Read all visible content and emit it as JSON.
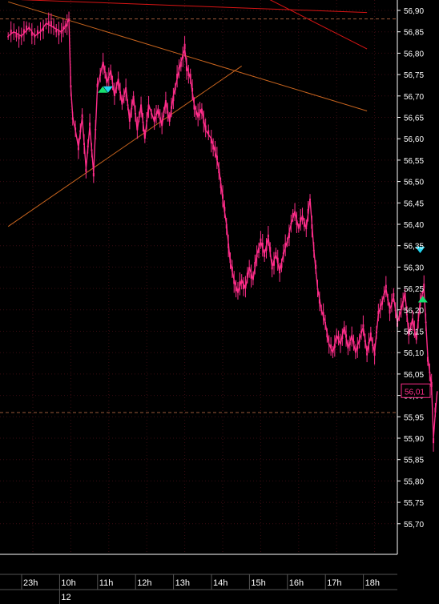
{
  "chart_data": {
    "type": "candlestick",
    "colors": {
      "background": "#000000",
      "candle": "#ff2d8a",
      "grid": "#3a0c12",
      "axis_text": "#ffffff",
      "trendline_orange": "#c8641e",
      "trendline_red": "#d81414",
      "last_price_box": "#ff2d8a",
      "signal_buy": "#19e070",
      "signal_sell": "#22d5f0"
    },
    "y_axis": {
      "min": 55.66,
      "max": 56.92,
      "ticks": [
        "56,90",
        "56,85",
        "56,80",
        "56,75",
        "56,70",
        "56,65",
        "56,60",
        "56,55",
        "56,50",
        "56,45",
        "56,40",
        "56,35",
        "56,30",
        "56,25",
        "56,20",
        "56,15",
        "56,10",
        "56,05",
        "56,00",
        "55,95",
        "55,90",
        "55,85",
        "55,80",
        "55,75",
        "55,70"
      ]
    },
    "last_price": {
      "value": 56.01,
      "label": "56,01"
    },
    "x_axis": {
      "ticks": [
        {
          "t": 23,
          "label": "23h"
        },
        {
          "t": 24,
          "label": "10h"
        },
        {
          "t": 25,
          "label": "11h"
        },
        {
          "t": 26,
          "label": "12h"
        },
        {
          "t": 27,
          "label": "13h"
        },
        {
          "t": 28,
          "label": "14h"
        },
        {
          "t": 29,
          "label": "15h"
        },
        {
          "t": 30,
          "label": "16h"
        },
        {
          "t": 31,
          "label": "17h"
        },
        {
          "t": 32,
          "label": "18h"
        }
      ],
      "date_label": {
        "t": 24,
        "label": "12"
      }
    },
    "hlines": [
      56.88,
      55.96
    ],
    "trendlines": [
      {
        "color": "trendline_orange",
        "from": [
          22.35,
          56.92
        ],
        "to": [
          31.8,
          56.665
        ]
      },
      {
        "color": "trendline_red",
        "from": [
          22.7,
          56.925
        ],
        "to": [
          31.8,
          56.895
        ]
      },
      {
        "color": "trendline_red",
        "from": [
          28.8,
          56.945
        ],
        "to": [
          31.8,
          56.81
        ]
      },
      {
        "color": "trendline_orange",
        "from": [
          22.35,
          56.395
        ],
        "to": [
          28.5,
          56.77
        ]
      }
    ],
    "series": [
      {
        "type": "close_path",
        "points": [
          [
            22.35,
            56.84
          ],
          [
            22.5,
            56.85
          ],
          [
            22.7,
            56.84
          ],
          [
            22.9,
            56.86
          ],
          [
            23.05,
            56.84
          ],
          [
            23.2,
            56.85
          ],
          [
            23.35,
            56.87
          ],
          [
            23.55,
            56.86
          ],
          [
            23.75,
            56.85
          ],
          [
            23.85,
            56.86
          ],
          [
            23.95,
            56.88
          ],
          [
            24.0,
            56.72
          ],
          [
            24.05,
            56.65
          ],
          [
            24.12,
            56.62
          ],
          [
            24.2,
            56.58
          ],
          [
            24.3,
            56.65
          ],
          [
            24.4,
            56.53
          ],
          [
            24.5,
            56.63
          ],
          [
            24.6,
            56.52
          ],
          [
            24.7,
            56.72
          ],
          [
            24.85,
            56.78
          ],
          [
            24.95,
            56.73
          ],
          [
            25.05,
            56.76
          ],
          [
            25.15,
            56.7
          ],
          [
            25.25,
            56.74
          ],
          [
            25.35,
            56.68
          ],
          [
            25.45,
            56.72
          ],
          [
            25.55,
            56.64
          ],
          [
            25.65,
            56.7
          ],
          [
            25.75,
            56.62
          ],
          [
            25.85,
            56.68
          ],
          [
            25.95,
            56.6
          ],
          [
            26.05,
            56.68
          ],
          [
            26.2,
            56.64
          ],
          [
            26.3,
            56.67
          ],
          [
            26.4,
            56.63
          ],
          [
            26.5,
            56.69
          ],
          [
            26.6,
            56.64
          ],
          [
            26.7,
            56.7
          ],
          [
            26.8,
            56.74
          ],
          [
            26.9,
            56.78
          ],
          [
            27.0,
            56.81
          ],
          [
            27.05,
            56.77
          ],
          [
            27.15,
            56.74
          ],
          [
            27.25,
            56.68
          ],
          [
            27.35,
            56.65
          ],
          [
            27.45,
            56.67
          ],
          [
            27.55,
            56.62
          ],
          [
            27.7,
            56.6
          ],
          [
            27.8,
            56.57
          ],
          [
            27.9,
            56.53
          ],
          [
            28.0,
            56.46
          ],
          [
            28.1,
            56.4
          ],
          [
            28.2,
            56.31
          ],
          [
            28.3,
            56.27
          ],
          [
            28.4,
            56.24
          ],
          [
            28.5,
            56.27
          ],
          [
            28.6,
            56.25
          ],
          [
            28.7,
            56.3
          ],
          [
            28.8,
            56.27
          ],
          [
            28.9,
            56.33
          ],
          [
            29.0,
            56.36
          ],
          [
            29.1,
            56.33
          ],
          [
            29.2,
            56.37
          ],
          [
            29.3,
            56.3
          ],
          [
            29.4,
            56.33
          ],
          [
            29.5,
            56.29
          ],
          [
            29.6,
            56.33
          ],
          [
            29.7,
            56.36
          ],
          [
            29.8,
            56.4
          ],
          [
            29.9,
            56.43
          ],
          [
            30.0,
            56.39
          ],
          [
            30.1,
            56.42
          ],
          [
            30.2,
            56.39
          ],
          [
            30.3,
            56.46
          ],
          [
            30.4,
            56.34
          ],
          [
            30.5,
            56.25
          ],
          [
            30.6,
            56.2
          ],
          [
            30.7,
            56.17
          ],
          [
            30.8,
            56.12
          ],
          [
            30.9,
            56.1
          ],
          [
            31.0,
            56.14
          ],
          [
            31.1,
            56.12
          ],
          [
            31.2,
            56.16
          ],
          [
            31.3,
            56.11
          ],
          [
            31.4,
            56.14
          ],
          [
            31.5,
            56.1
          ],
          [
            31.6,
            56.13
          ],
          [
            31.7,
            56.16
          ],
          [
            31.8,
            56.1
          ],
          [
            31.9,
            56.14
          ],
          [
            32.0,
            56.1
          ],
          [
            32.1,
            56.19
          ],
          [
            32.2,
            56.22
          ],
          [
            32.3,
            56.25
          ],
          [
            32.4,
            56.2
          ],
          [
            32.5,
            56.23
          ],
          [
            32.6,
            56.17
          ],
          [
            32.7,
            56.2
          ],
          [
            32.8,
            56.24
          ],
          [
            32.9,
            56.14
          ],
          [
            33.0,
            56.18
          ],
          [
            33.1,
            56.13
          ],
          [
            33.2,
            56.22
          ],
          [
            33.3,
            56.25
          ],
          [
            33.4,
            56.09
          ],
          [
            33.5,
            56.02
          ],
          [
            33.55,
            55.9
          ],
          [
            33.6,
            55.96
          ],
          [
            33.65,
            56.01
          ]
        ]
      }
    ],
    "signals": [
      {
        "type": "buy",
        "t": 24.84,
        "price": 56.715
      },
      {
        "type": "sell",
        "t": 24.98,
        "price": 56.715
      },
      {
        "type": "sell",
        "t": 33.2,
        "price": 56.34
      },
      {
        "type": "buy",
        "t": 33.27,
        "price": 56.225
      }
    ]
  }
}
